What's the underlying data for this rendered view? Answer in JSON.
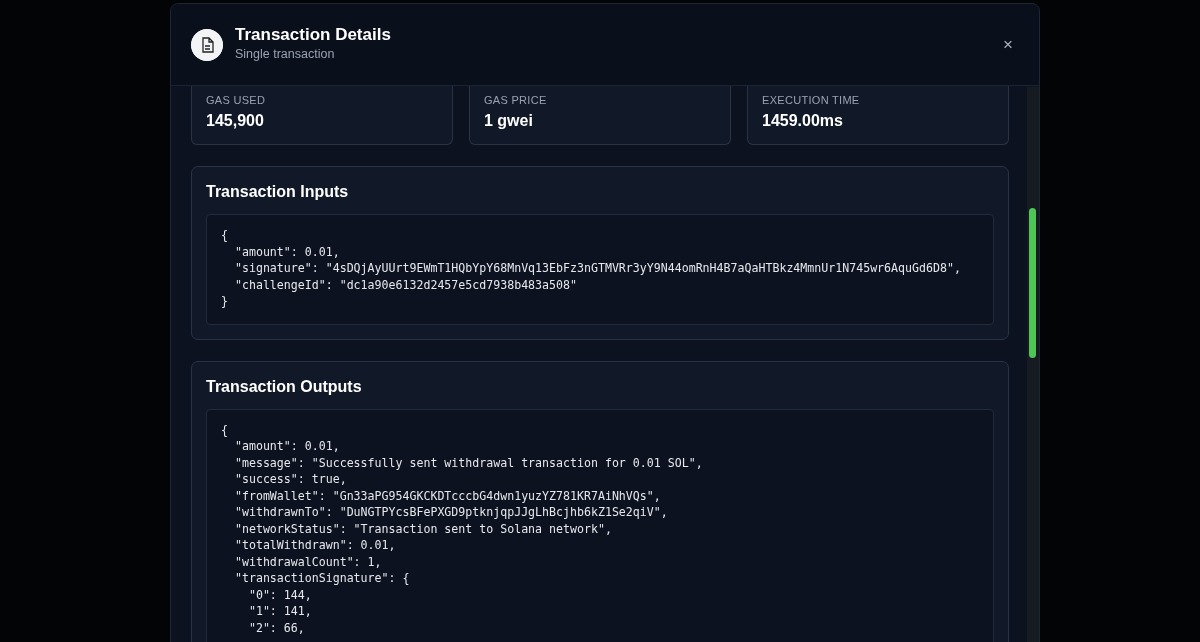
{
  "modal": {
    "title": "Transaction Details",
    "subtitle": "Single transaction",
    "close": "×"
  },
  "stats": [
    {
      "label": "GAS USED",
      "value": "145,900"
    },
    {
      "label": "GAS PRICE",
      "value": "1 gwei"
    },
    {
      "label": "EXECUTION TIME",
      "value": "1459.00ms"
    }
  ],
  "sections": [
    {
      "title": "Transaction Inputs",
      "code": [
        "{",
        "  \"amount\": 0.01,",
        "  \"signature\": \"4sDQjAyUUrt9EWmT1HQbYpY68MnVq13EbFz3nGTMVRr3yY9N44omRnH4B7aQaHTBkz4MmnUr1N745wr6AquGd6D8\",",
        "  \"challengeId\": \"dc1a90e6132d2457e5cd7938b483a508\"",
        "}"
      ]
    },
    {
      "title": "Transaction Outputs",
      "code": [
        "{",
        "  \"amount\": 0.01,",
        "  \"message\": \"Successfully sent withdrawal transaction for 0.01 SOL\",",
        "  \"success\": true,",
        "  \"fromWallet\": \"Gn33aPG954GKCKDTcccbG4dwn1yuzYZ781KR7AiNhVQs\",",
        "  \"withdrawnTo\": \"DuNGTPYcsBFePXGD9ptknjqpJJgLhBcjhb6kZ1Se2qiV\",",
        "  \"networkStatus\": \"Transaction sent to Solana network\",",
        "  \"totalWithdrawn\": 0.01,",
        "  \"withdrawalCount\": 1,",
        "  \"transactionSignature\": {",
        "    \"0\": 144,",
        "    \"1\": 141,",
        "    \"2\": 66,"
      ]
    }
  ]
}
